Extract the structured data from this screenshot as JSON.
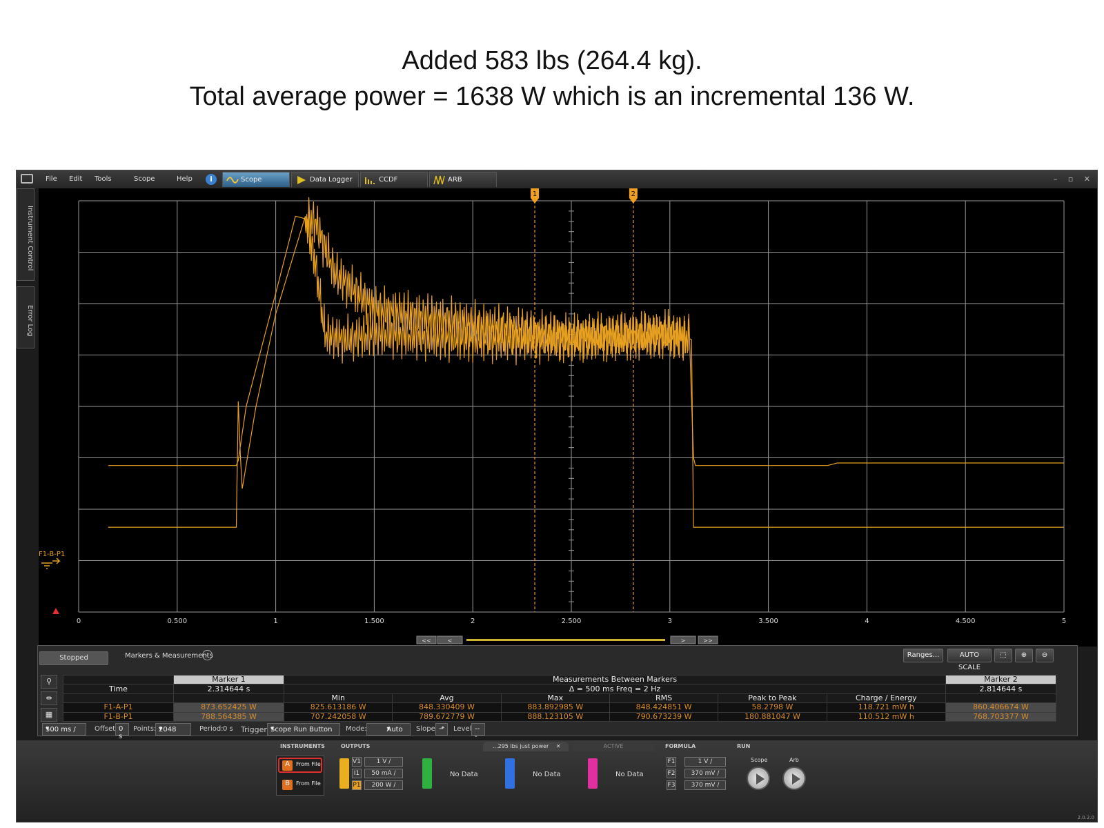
{
  "slide": {
    "title_line1": "Added 583 lbs (264.4 kg).",
    "title_line2": "Total average power = 1638 W which is an incremental 136 W."
  },
  "menu": [
    "File",
    "Edit",
    "Tools",
    "Scope",
    "Help"
  ],
  "tabs": [
    {
      "label": "Scope",
      "icon": "sine-wave-icon",
      "active": true
    },
    {
      "label": "Data Logger",
      "icon": "play-icon",
      "active": false
    },
    {
      "label": "CCDF",
      "icon": "histogram-icon",
      "active": false
    },
    {
      "label": "ARB",
      "icon": "arb-wave-icon",
      "active": false
    }
  ],
  "sidetabs": {
    "instrument_control": "Instrument Control",
    "error_log": "Error Log"
  },
  "scope": {
    "x_ticks": [
      "0",
      "0.500",
      "1",
      "1.500",
      "2",
      "2.500",
      "3",
      "3.500",
      "4",
      "4.500",
      "5"
    ],
    "marker1_label": "1",
    "marker2_label": "2",
    "marker1_time": 2.314644,
    "marker2_time": 2.814644,
    "channel_label": "F1-B-P1",
    "trace_color": "#e8a020"
  },
  "chart_data": {
    "type": "line",
    "xlim": [
      0,
      5
    ],
    "x_ticks": [
      "0",
      "0.500",
      "1",
      "1.500",
      "2",
      "2.500",
      "3",
      "3.500",
      "4",
      "4.500",
      "5"
    ],
    "series": [
      {
        "name": "F1-A-P1",
        "x": [
          0.15,
          0.8,
          0.81,
          0.85,
          1.0,
          1.1,
          1.2,
          1.3,
          1.5,
          2.0,
          2.5,
          3.0,
          3.1,
          3.12,
          3.13,
          3.8,
          3.85,
          5.0
        ],
        "y": [
          2.85,
          2.85,
          2.95,
          4.0,
          6.2,
          7.7,
          7.6,
          6.6,
          5.9,
          5.6,
          5.35,
          5.4,
          5.3,
          3.0,
          2.85,
          2.85,
          2.9,
          2.9
        ]
      },
      {
        "name": "F1-B-P1",
        "x": [
          0.15,
          0.8,
          0.81,
          0.82,
          0.83,
          0.9,
          1.0,
          1.15,
          1.2,
          1.25,
          1.35,
          1.5,
          2.0,
          2.5,
          3.0,
          3.11,
          3.12,
          5.0
        ],
        "y": [
          1.65,
          1.65,
          4.1,
          3.1,
          2.4,
          4.0,
          5.8,
          7.7,
          6.8,
          5.4,
          5.3,
          5.4,
          5.3,
          5.3,
          5.4,
          5.3,
          1.65,
          1.65
        ]
      }
    ],
    "marker_times": [
      2.314644,
      2.814644
    ]
  },
  "scrollbar": {
    "first": "<<",
    "prev": "<",
    "next": ">",
    "last": ">>"
  },
  "controls": {
    "status": "Stopped",
    "panel_title": "Markers & Measurements",
    "ranges": "Ranges...",
    "autoscale": "AUTO SCALE"
  },
  "measurements": {
    "marker1_head": "Marker 1",
    "marker2_head": "Marker 2",
    "between_head": "Measurements Between Markers",
    "time_label": "Time",
    "marker1_time": "2.314644 s",
    "marker2_time": "2.814644 s",
    "delta": "Δ = 500 ms   Freq = 2 Hz",
    "columns": [
      "Min",
      "Avg",
      "Max",
      "RMS",
      "Peak to Peak",
      "Charge / Energy"
    ],
    "rows": [
      {
        "name": "F1-A-P1",
        "m1": "873.652425 W",
        "vals": [
          "825.613186 W",
          "848.330409 W",
          "883.892985 W",
          "848.424851 W",
          "58.2798 W",
          "118.721 mW h"
        ],
        "m2": "860.406674 W"
      },
      {
        "name": "F1-B-P1",
        "m1": "788.564385 W",
        "vals": [
          "707.242058 W",
          "789.672779 W",
          "888.123105 W",
          "790.673239 W",
          "180.881047 W",
          "110.512 mW h"
        ],
        "m2": "768.703377 W"
      }
    ]
  },
  "acq": {
    "timebase": "500 ms /",
    "offset_label": "Offset:",
    "offset": "0 s",
    "points_label": "Points:",
    "points": "2048",
    "period_label": "Period:",
    "period": "0 s",
    "trigger_label": "Trigger",
    "trigger": "Scope Run Button",
    "mode_label": "Mode:",
    "mode": "Auto",
    "slope_label": "Slope:",
    "level_label": "Level:",
    "level": "---"
  },
  "footer": {
    "instruments": "INSTRUMENTS",
    "outputs": "OUTPUTS",
    "file_tab": "...295 lbs just power",
    "active": "ACTIVE",
    "formula": "FORMULA",
    "run": "RUN",
    "inst_a": "From File",
    "inst_b": "From File",
    "v1": "1 V /",
    "i1": "50 mA /",
    "p1": "200 W /",
    "nodata": "No Data",
    "f1": "1 V /",
    "f2": "370 mV /",
    "f3": "370 mV /",
    "scope_run": "Scope",
    "arb_run": "Arb",
    "version": "2.0.2.0"
  }
}
